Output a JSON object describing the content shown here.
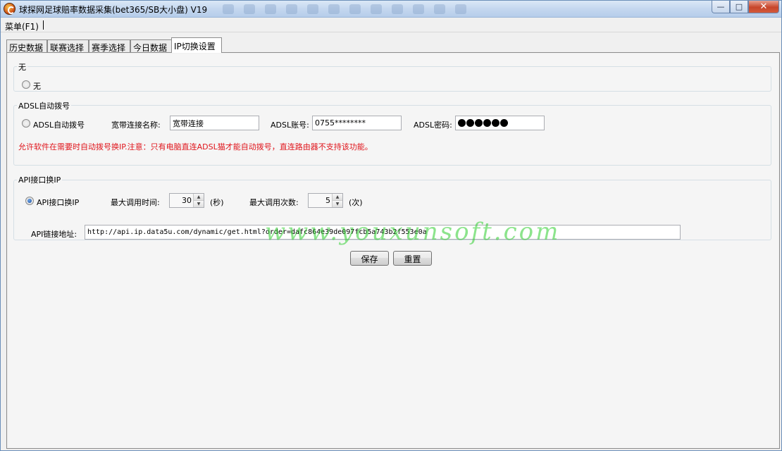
{
  "window": {
    "title": "球探网足球赔率数据采集(bet365/SB大小盘) V19",
    "controls": {
      "minimize": "—",
      "maximize": "□",
      "close": "✕"
    }
  },
  "menubar": {
    "menu_label": "菜单(F1)"
  },
  "tabs": [
    {
      "label": "历史数据",
      "active": false
    },
    {
      "label": "联赛选择",
      "active": false
    },
    {
      "label": "赛季选择",
      "active": false
    },
    {
      "label": "今日数据",
      "active": false
    },
    {
      "label": "IP切换设置",
      "active": true
    }
  ],
  "groups": {
    "none": {
      "title": "无",
      "radio_label": "无"
    },
    "adsl": {
      "title": "ADSL自动拨号",
      "radio_label": "ADSL自动拨号",
      "connection_name_label": "宽带连接名称:",
      "connection_name_value": "宽带连接",
      "account_label": "ADSL账号:",
      "account_value": "0755********",
      "password_label": "ADSL密码:",
      "notice": "允许软件在需要时自动拨号换IP.注意：只有电脑直连ADSL猫才能自动拨号，直连路由器不支持该功能。"
    },
    "api": {
      "title": "API接口换IP",
      "radio_label": "API接口换IP",
      "max_time_label": "最大调用时间:",
      "max_time_value": "30",
      "max_time_unit": "(秒)",
      "max_count_label": "最大调用次数:",
      "max_count_value": "5",
      "max_count_unit": "(次)",
      "url_label": "API链接地址:",
      "url_value": "http://api.ip.data5u.com/dynamic/get.html?order=dafc864e39de097fcb5a743b2f553e0a"
    }
  },
  "actions": {
    "save_label": "保存",
    "reset_label": "重置"
  },
  "watermark": "www.youxunsoft.com",
  "colors": {
    "notice_red": "#e0141b",
    "watermark_green": "#2ecd2e",
    "titlebar_blue": "#c4d7ef"
  }
}
